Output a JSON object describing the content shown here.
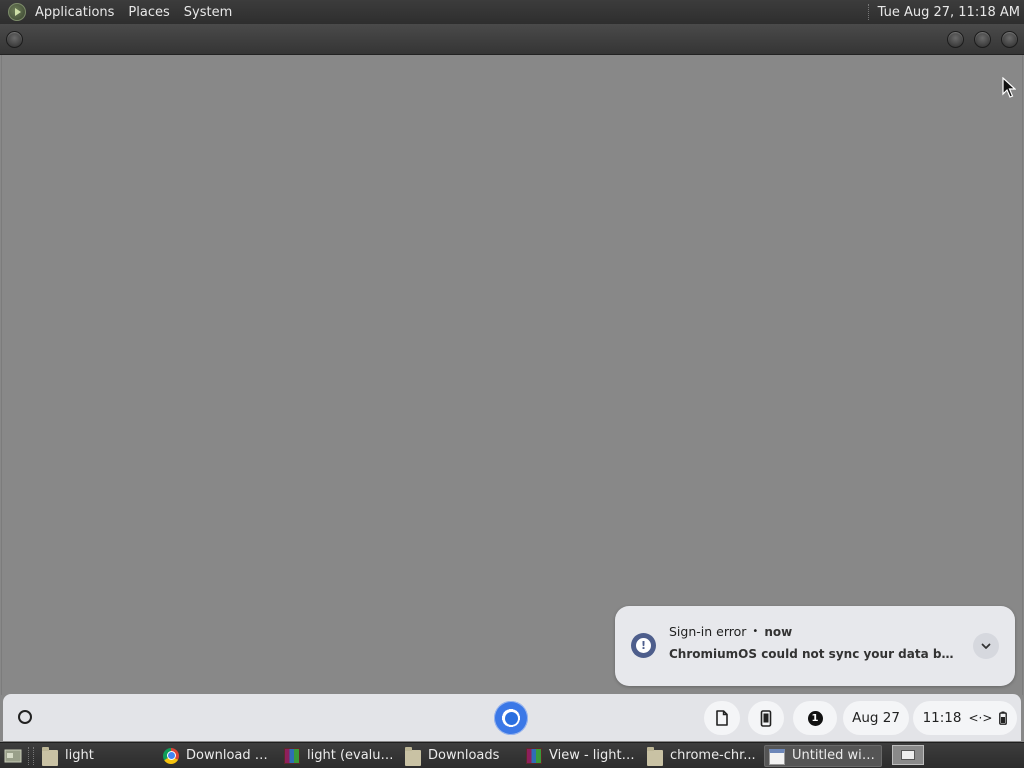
{
  "top_panel": {
    "menu": [
      "Applications",
      "Places",
      "System"
    ],
    "clock": "Tue Aug 27, 11:18 AM"
  },
  "notification": {
    "title": "Sign-in error",
    "separator": "•",
    "time": "now",
    "message": "ChromiumOS could not sync your data because your account sign-in details are out of date."
  },
  "shelf": {
    "notification_count": "1",
    "date": "Aug 27",
    "time": "11:18",
    "network_symbol": "<·>"
  },
  "taskbar": {
    "tasks": [
      {
        "label": "light",
        "icon": "folder-icon"
      },
      {
        "label": "Download h...",
        "icon": "chrome-icon"
      },
      {
        "label": "light (evalua...",
        "icon": "archive-icon"
      },
      {
        "label": "Downloads",
        "icon": "folder-icon"
      },
      {
        "label": "View - light....",
        "icon": "archive-icon"
      },
      {
        "label": "chrome-chr...",
        "icon": "folder-icon"
      },
      {
        "label": "Untitled win...",
        "icon": "window-icon"
      }
    ]
  },
  "colors": {
    "desktop": "#888888",
    "panel": "#333333",
    "shelf": "#e3e4e8",
    "notification_icon": "#4e5e8c",
    "chrome_blue": "#3b78e7"
  }
}
